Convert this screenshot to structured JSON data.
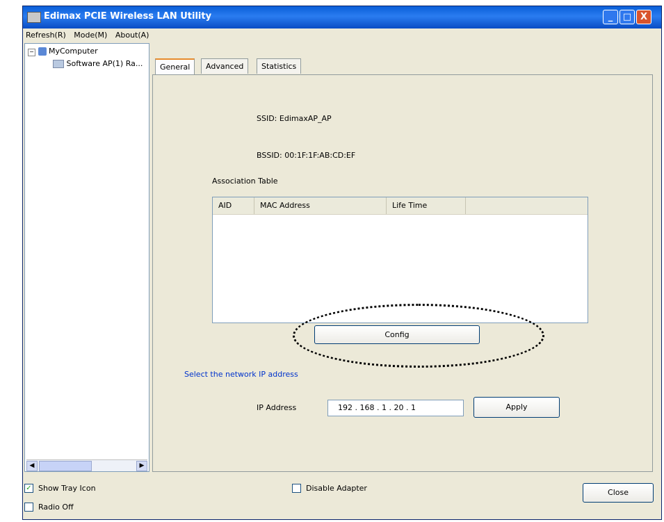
{
  "window": {
    "title": "Edimax PCIE Wireless LAN Utility",
    "minimize_label": "_",
    "maximize_label": "□",
    "close_label": "X"
  },
  "menu": {
    "items": [
      "Refresh(R)",
      "Mode(M)",
      "About(A)"
    ]
  },
  "tree": {
    "root_label": "MyComputer",
    "child_label": "Software AP(1) Ra..."
  },
  "tabs": {
    "items": [
      "General",
      "Advanced",
      "Statistics"
    ]
  },
  "general": {
    "ssid_text": "SSID: EdimaxAP_AP",
    "bssid_text": "BSSID: 00:1F:1F:AB:CD:EF",
    "association_table_label": "Association Table",
    "columns": [
      "AID",
      "MAC Address",
      "Life Time"
    ],
    "config_button": "Config",
    "link_text": "Select the network IP address",
    "ip_label": "IP Address",
    "ip_value": "192 . 168 . 1 . 20 . 1",
    "apply_button": "Apply"
  },
  "footer": {
    "show_tray_label": "Show Tray Icon",
    "show_tray_checked": "✓",
    "disable_adapter_label": "Disable Adapter",
    "radio_off_label": "Radio Off",
    "close_button": "Close"
  },
  "scroll": {
    "left_arrow": "◀",
    "right_arrow": "▶"
  }
}
